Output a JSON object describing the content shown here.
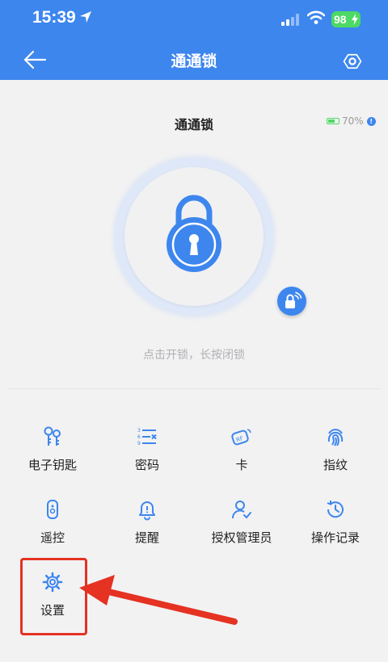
{
  "status_bar": {
    "time": "15:39",
    "battery": "98"
  },
  "nav": {
    "title": "通通锁"
  },
  "lock": {
    "name": "通通锁",
    "battery_level": "70%",
    "hint": "点击开锁，长按闭锁"
  },
  "features": [
    {
      "label": "电子钥匙",
      "icon": "ekey-icon"
    },
    {
      "label": "密码",
      "icon": "passcode-icon"
    },
    {
      "label": "卡",
      "icon": "card-icon"
    },
    {
      "label": "指纹",
      "icon": "fingerprint-icon"
    },
    {
      "label": "遥控",
      "icon": "remote-icon"
    },
    {
      "label": "提醒",
      "icon": "bell-icon"
    },
    {
      "label": "授权管理员",
      "icon": "admin-icon"
    },
    {
      "label": "操作记录",
      "icon": "history-icon"
    },
    {
      "label": "设置",
      "icon": "gear-icon"
    }
  ],
  "colors": {
    "primary": "#3d86ee",
    "annotation": "#e53222"
  }
}
